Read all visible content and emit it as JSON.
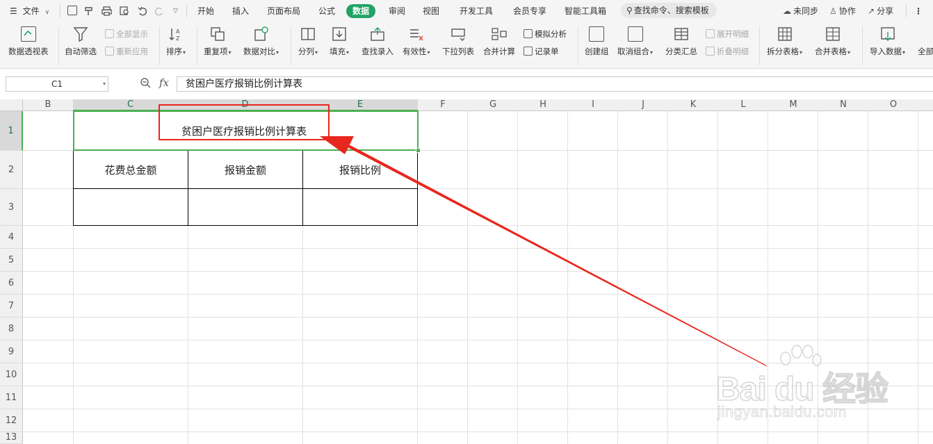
{
  "menu": {
    "file_label": "文件",
    "tabs": [
      "开始",
      "插入",
      "页面布局",
      "公式",
      "数据",
      "审阅",
      "视图",
      "开发工具",
      "会员专享",
      "智能工具箱"
    ],
    "active_tab": "数据",
    "search_label": "查找命令、搜索模板",
    "sync_label": "未同步",
    "collab_label": "协作",
    "share_label": "分享",
    "accent_color": "#21a366"
  },
  "ribbon": {
    "pivot": "数据透视表",
    "autofilter": "自动筛选",
    "show_all": "全部显示",
    "reapply": "重新应用",
    "sort": "排序",
    "duplicates": "重复项",
    "compare": "数据对比",
    "split_col": "分列",
    "fill": "填充",
    "lookup_entry": "查找录入",
    "validity": "有效性",
    "dropdown_list": "下拉列表",
    "consolidate": "合并计算",
    "what_if": "模拟分析",
    "record_form": "记录单",
    "create_group": "创建组",
    "ungroup": "取消组合",
    "subtotal": "分类汇总",
    "expand_detail": "展开明细",
    "collapse_detail": "折叠明细",
    "split_table": "拆分表格",
    "merge_table": "合并表格",
    "import_data": "导入数据",
    "all_partial": "全部"
  },
  "formula_bar": {
    "cell_ref": "C1",
    "fx_label": "fx",
    "content": "贫困户医疗报销比例计算表"
  },
  "grid": {
    "columns": [
      "B",
      "C",
      "D",
      "E",
      "F",
      "G",
      "H",
      "I",
      "J",
      "K",
      "L",
      "M",
      "N",
      "O"
    ],
    "rows": [
      "1",
      "2",
      "3",
      "4",
      "5",
      "6",
      "7",
      "8",
      "9",
      "10",
      "11",
      "12",
      "13"
    ],
    "selected_cell": "C1"
  },
  "sheet": {
    "title": "贫困户医疗报销比例计算表",
    "headers": [
      "花费总金额",
      "报销金额",
      "报销比例"
    ]
  },
  "watermark": {
    "logo_text": "Bai du 经验",
    "url": "jingyan.baidu.com"
  }
}
